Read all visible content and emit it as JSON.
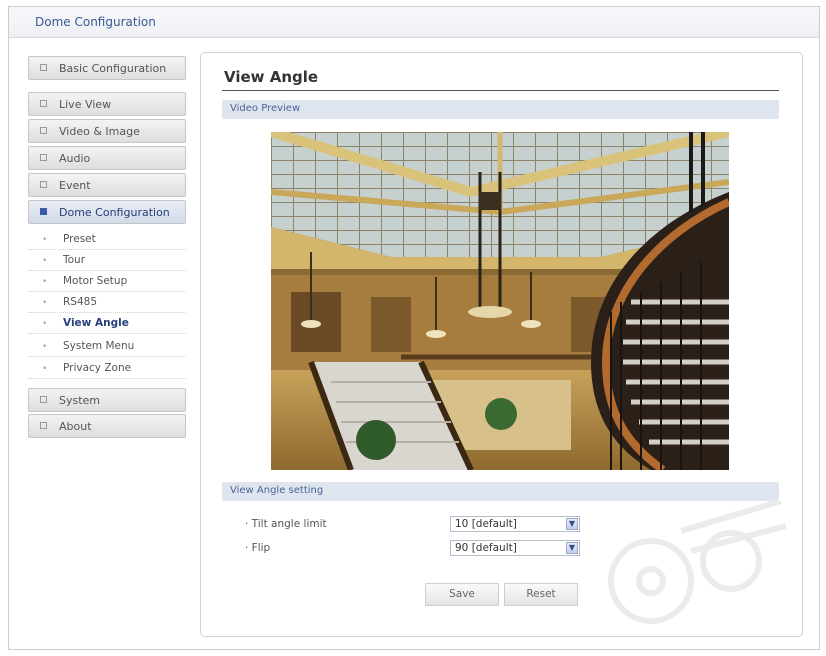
{
  "app": {
    "title": "Dome Configuration"
  },
  "sidebar": {
    "items": [
      {
        "label": "Basic Configuration"
      },
      {
        "label": "Live View"
      },
      {
        "label": "Video & Image"
      },
      {
        "label": "Audio"
      },
      {
        "label": "Event"
      },
      {
        "label": "Dome Configuration"
      },
      {
        "label": "System"
      },
      {
        "label": "About"
      }
    ],
    "subitems": [
      {
        "label": "Preset"
      },
      {
        "label": "Tour"
      },
      {
        "label": "Motor Setup"
      },
      {
        "label": "RS485"
      },
      {
        "label": "View Angle"
      },
      {
        "label": "System Menu"
      },
      {
        "label": "Privacy Zone"
      }
    ]
  },
  "main": {
    "title": "View Angle",
    "preview_section": "Video Preview",
    "settings_section": "View Angle setting",
    "tilt": {
      "label": "· Tilt angle limit",
      "value": "10   [default]"
    },
    "flip": {
      "label": "· Flip",
      "value": "90   [default]"
    },
    "save_label": "Save",
    "reset_label": "Reset"
  },
  "colors": {
    "accent": "#3b5aa8",
    "section_bg": "#dfe5ef",
    "link": "#3a5a90"
  }
}
